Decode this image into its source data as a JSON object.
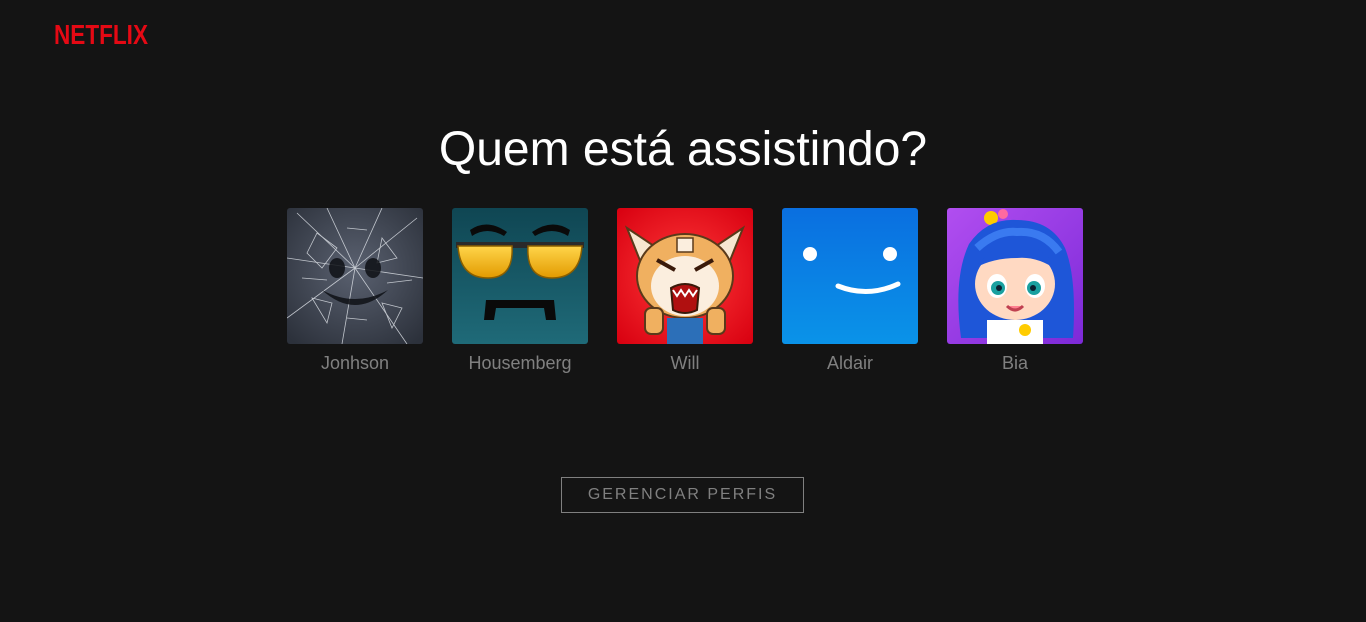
{
  "brand": {
    "name": "NETFLIX",
    "color": "#e50914"
  },
  "header": {
    "title": "Quem está assistindo?"
  },
  "profiles": [
    {
      "name": "Jonhson",
      "avatar": "broken-glass-smiley-icon"
    },
    {
      "name": "Housemberg",
      "avatar": "sunglasses-mustache-face-icon"
    },
    {
      "name": "Will",
      "avatar": "red-panda-rage-icon"
    },
    {
      "name": "Aldair",
      "avatar": "blue-smiley-face-icon"
    },
    {
      "name": "Bia",
      "avatar": "cartoon-girl-blue-hair-icon"
    }
  ],
  "actions": {
    "manage_profiles_label": "GERENCIAR PERFIS"
  },
  "colors": {
    "background": "#141414",
    "text_muted": "#808080"
  }
}
